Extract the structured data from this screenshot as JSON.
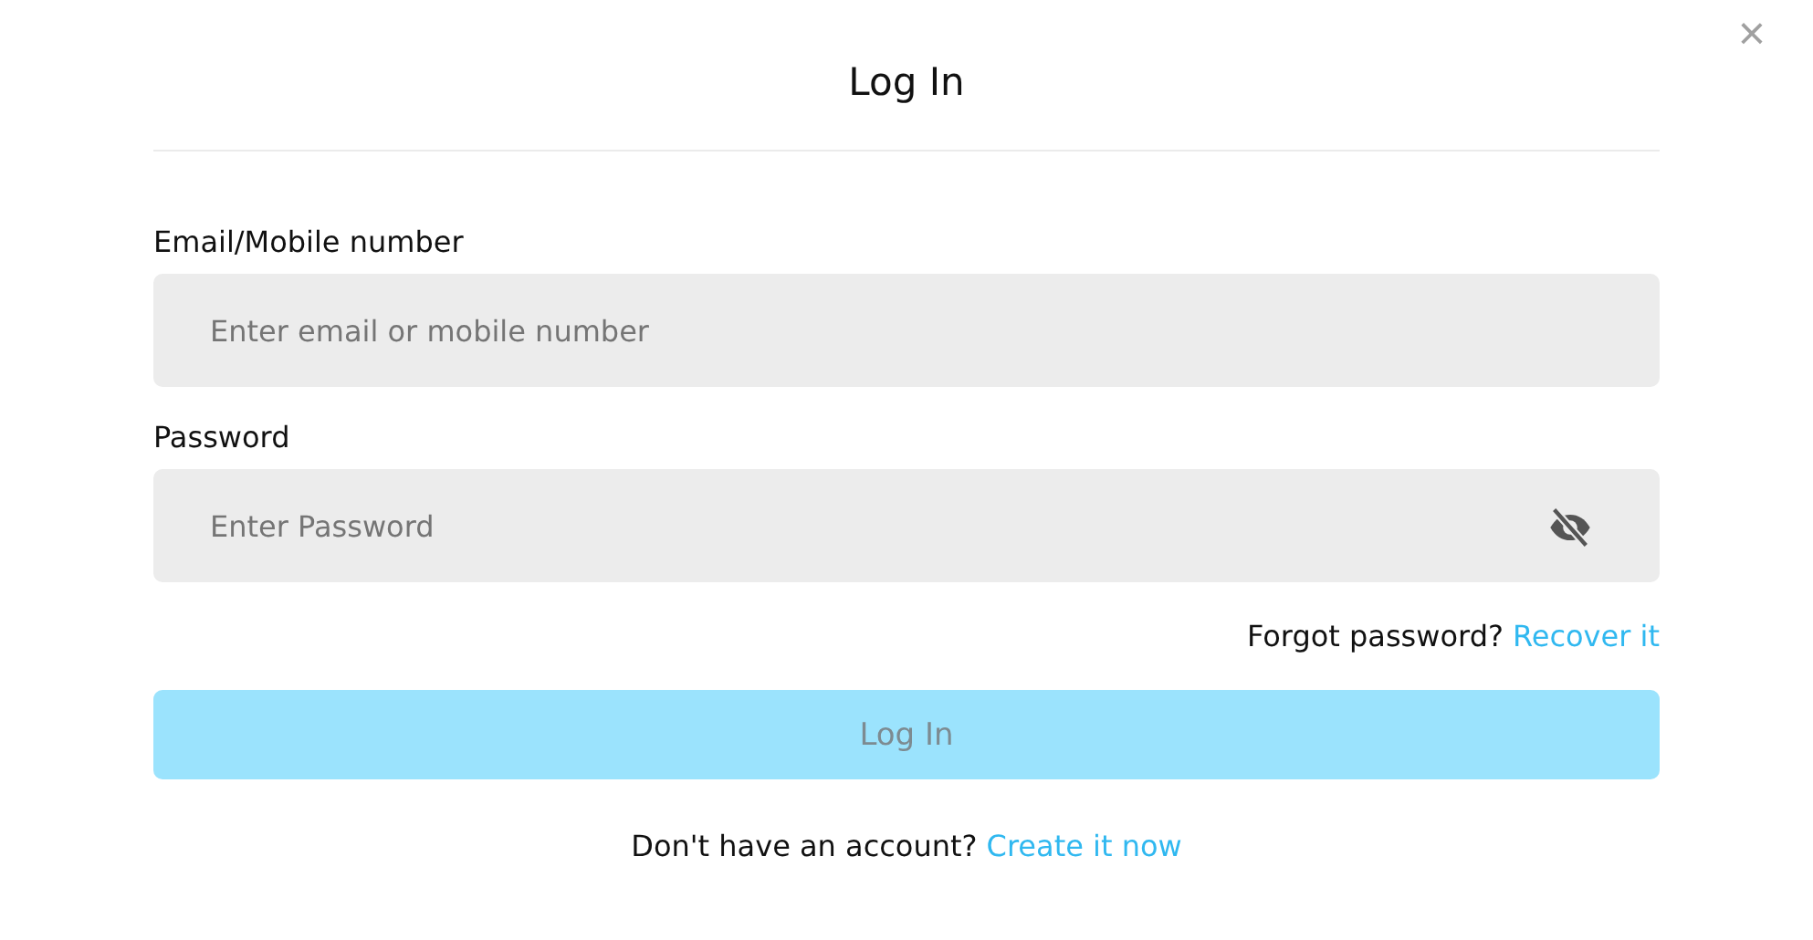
{
  "dialog": {
    "title": "Log In",
    "close": "×"
  },
  "fields": [
    {
      "label": "Email/Mobile number",
      "placeholder": "Enter email or mobile number",
      "kind": "text"
    },
    {
      "label": "Password",
      "placeholder": "Enter Password",
      "kind": "password",
      "password_visible": false
    }
  ],
  "forgot": {
    "text": "Forgot password?",
    "link": "Recover it"
  },
  "submit": {
    "label": "Log In",
    "disabled": true
  },
  "signup": {
    "text": "Don't have an account?",
    "link": "Create it now"
  }
}
